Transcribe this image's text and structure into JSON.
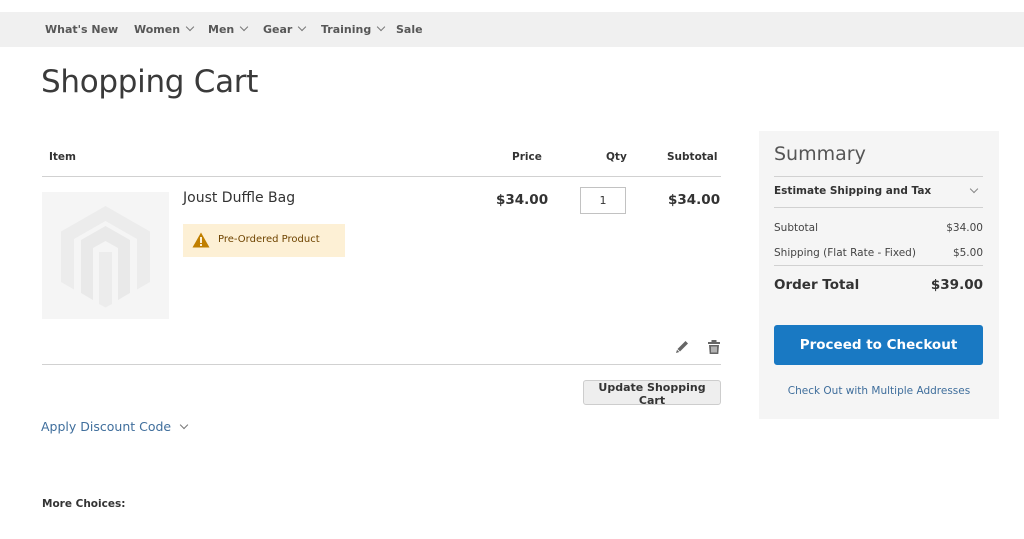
{
  "nav": {
    "items": [
      {
        "label": "What's New",
        "has_dropdown": false
      },
      {
        "label": "Women",
        "has_dropdown": true
      },
      {
        "label": "Men",
        "has_dropdown": true
      },
      {
        "label": "Gear",
        "has_dropdown": true
      },
      {
        "label": "Training",
        "has_dropdown": true
      },
      {
        "label": "Sale",
        "has_dropdown": false
      }
    ]
  },
  "page": {
    "title": "Shopping Cart"
  },
  "cart": {
    "columns": {
      "item": "Item",
      "price": "Price",
      "qty": "Qty",
      "subtotal": "Subtotal"
    },
    "items": [
      {
        "name": "Joust Duffle Bag",
        "badge": "Pre-Ordered Product",
        "price": "$34.00",
        "qty": "1",
        "subtotal": "$34.00",
        "image": "magento-placeholder-logo"
      }
    ],
    "update_button": "Update Shopping Cart",
    "discount_label": "Apply Discount Code",
    "more_choices": "More Choices:"
  },
  "summary": {
    "title": "Summary",
    "estimate_label": "Estimate Shipping and Tax",
    "rows": [
      {
        "label": "Subtotal",
        "value": "$34.00"
      },
      {
        "label": "Shipping (Flat Rate - Fixed)",
        "value": "$5.00"
      }
    ],
    "total_label": "Order Total",
    "total_value": "$39.00",
    "checkout_button": "Proceed to Checkout",
    "multi_address_link": "Check Out with Multiple Addresses"
  },
  "colors": {
    "accent": "#1979c3",
    "nav_bg": "#f0f0f0",
    "summary_bg": "#f5f5f5",
    "warning_bg": "#fdf0d5",
    "warning_icon": "#c07f00",
    "link": "#3f6e9c"
  }
}
